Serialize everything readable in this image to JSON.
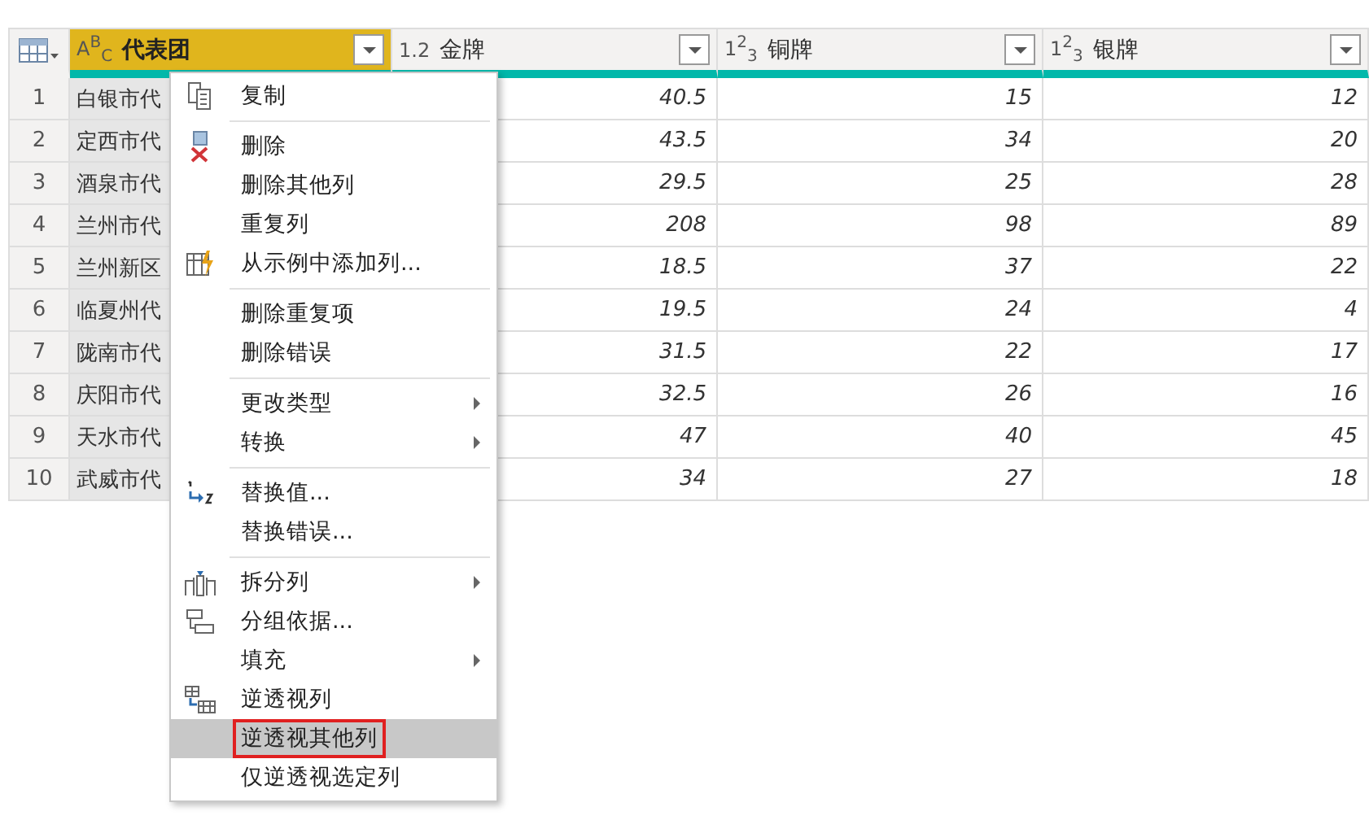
{
  "table": {
    "columns": [
      {
        "type": "A$^{B}$$_{C}$",
        "label": "代表团",
        "selected": true
      },
      {
        "type": "1.2",
        "label": "金牌",
        "selected": false
      },
      {
        "type": "1$^{2}$$_{3}$",
        "label": "铜牌",
        "selected": false
      },
      {
        "type": "1$^{2}$$_{3}$",
        "label": "银牌",
        "selected": false
      }
    ],
    "rows": [
      {
        "index": "1",
        "cells": [
          "白银市代",
          "40.5",
          "15",
          "12"
        ]
      },
      {
        "index": "2",
        "cells": [
          "定西市代",
          "43.5",
          "34",
          "20"
        ]
      },
      {
        "index": "3",
        "cells": [
          "酒泉市代",
          "29.5",
          "25",
          "28"
        ]
      },
      {
        "index": "4",
        "cells": [
          "兰州市代",
          "208",
          "98",
          "89"
        ]
      },
      {
        "index": "5",
        "cells": [
          "兰州新区",
          "18.5",
          "37",
          "22"
        ]
      },
      {
        "index": "6",
        "cells": [
          "临夏州代",
          "19.5",
          "24",
          "4"
        ]
      },
      {
        "index": "7",
        "cells": [
          "陇南市代",
          "31.5",
          "22",
          "17"
        ]
      },
      {
        "index": "8",
        "cells": [
          "庆阳市代",
          "32.5",
          "26",
          "16"
        ]
      },
      {
        "index": "9",
        "cells": [
          "天水市代",
          "47",
          "40",
          "45"
        ]
      },
      {
        "index": "10",
        "cells": [
          "武威市代",
          "34",
          "27",
          "18"
        ]
      }
    ]
  },
  "context_menu": {
    "groups": [
      [
        {
          "label": "复制",
          "kind": "copy",
          "submenu": false,
          "selected": false,
          "outlined": false
        }
      ],
      [
        {
          "label": "删除",
          "kind": "delete",
          "submenu": false,
          "selected": false,
          "outlined": false
        },
        {
          "label": "删除其他列",
          "submenu": false,
          "selected": false,
          "outlined": false
        },
        {
          "label": "重复列",
          "submenu": false,
          "selected": false,
          "outlined": false
        },
        {
          "label": "从示例中添加列...",
          "kind": "examples",
          "submenu": false,
          "selected": false,
          "outlined": false
        }
      ],
      [
        {
          "label": "删除重复项",
          "submenu": false,
          "selected": false,
          "outlined": false
        },
        {
          "label": "删除错误",
          "submenu": false,
          "selected": false,
          "outlined": false
        }
      ],
      [
        {
          "label": "更改类型",
          "submenu": true,
          "selected": false,
          "outlined": false
        },
        {
          "label": "转换",
          "submenu": true,
          "selected": false,
          "outlined": false
        }
      ],
      [
        {
          "label": "替换值...",
          "kind": "replace",
          "submenu": false,
          "selected": false,
          "outlined": false
        },
        {
          "label": "替换错误...",
          "submenu": false,
          "selected": false,
          "outlined": false
        }
      ],
      [
        {
          "label": "拆分列",
          "kind": "split",
          "submenu": true,
          "selected": false,
          "outlined": false
        },
        {
          "label": "分组依据...",
          "kind": "group",
          "submenu": false,
          "selected": false,
          "outlined": false
        },
        {
          "label": "填充",
          "submenu": true,
          "selected": false,
          "outlined": false
        },
        {
          "label": "逆透视列",
          "kind": "unpivot",
          "submenu": false,
          "selected": false,
          "outlined": false
        },
        {
          "label": "逆透视其他列",
          "submenu": false,
          "selected": true,
          "outlined": true
        },
        {
          "label": "仅逆透视选定列",
          "submenu": false,
          "selected": false,
          "outlined": false
        }
      ]
    ]
  }
}
